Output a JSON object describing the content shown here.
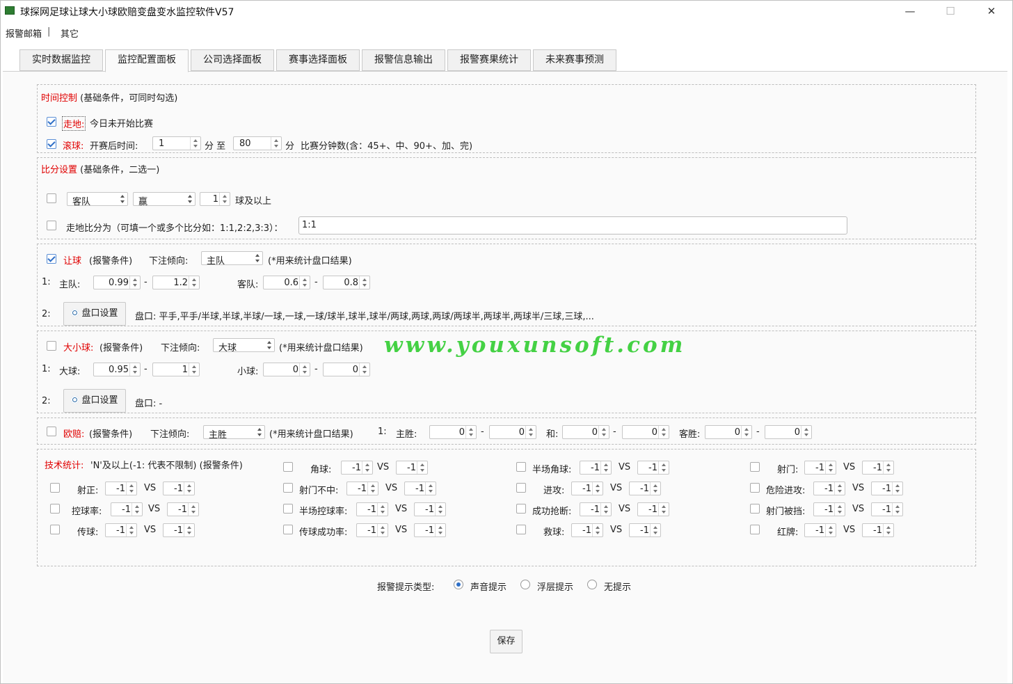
{
  "window": {
    "title": "球探网足球让球大小球欧赔变盘变水监控软件V57",
    "minimize": "—",
    "maximize": "☐",
    "close": "✕",
    "icon_color": "#2e7d32"
  },
  "menu": {
    "item1": "报警邮箱",
    "sep": "|",
    "item2": "其它"
  },
  "tabs": [
    "实时数据监控",
    "监控配置面板",
    "公司选择面板",
    "赛事选择面板",
    "报警信息输出",
    "报警赛果统计",
    "未来赛事预测"
  ],
  "time": {
    "title": "时间控制",
    "subtitle": "(基础条件，可同时勾选)",
    "zoudi_label": "走地:",
    "zoudi_desc": "今日未开始比赛",
    "gunqiu_label": "滚球:",
    "gunqiu_pre": "开赛后时间:",
    "from": "1",
    "fen_zhi": "分 至",
    "to": "80",
    "fen": "分",
    "desc": "比赛分钟数(含：45+、中、90+、加、完)"
  },
  "score": {
    "title": "比分设置",
    "subtitle": "(基础条件，二选一)",
    "team": "客队",
    "result": "赢",
    "goals": "1",
    "goals_suffix": "球及以上",
    "zoudi_label": "走地比分为（可填一个或多个比分如：1:1,2:2,3:3）：",
    "zoudi_value": "1:1"
  },
  "handicap": {
    "title": "让球",
    "cond": "(报警条件)",
    "bias_label": "下注倾向:",
    "bias": "主队",
    "note": "(*用来统计盘口结果)",
    "row1": "1:",
    "home_label": "主队:",
    "home_min": "0.99",
    "home_max": "1.2",
    "away_label": "客队:",
    "away_min": "0.6",
    "away_max": "0.8",
    "dash": "-",
    "row2": "2:",
    "btn": "盘口设置",
    "pankou": "盘口: 平手,平手/半球,半球,半球/一球,一球,一球/球半,球半,球半/两球,两球,两球/两球半,两球半,两球半/三球,三球,..."
  },
  "ou": {
    "title": "大小球:",
    "cond": "(报警条件)",
    "bias_label": "下注倾向:",
    "bias": "大球",
    "note": "(*用来统计盘口结果)",
    "row1": "1:",
    "over_label": "大球:",
    "over_min": "0.95",
    "over_max": "1",
    "under_label": "小球:",
    "under_min": "0",
    "under_max": "0",
    "dash": "-",
    "row2": "2:",
    "btn": "盘口设置",
    "pankou": "盘口: -"
  },
  "euro": {
    "title": "欧赔:",
    "cond": "(报警条件)",
    "bias_label": "下注倾向:",
    "bias": "主胜",
    "note": "(*用来统计盘口结果)",
    "row1": "1:",
    "home_label": "主胜:",
    "home_min": "0",
    "home_max": "0",
    "draw_label": "和:",
    "draw_min": "0",
    "draw_max": "0",
    "away_label": "客胜:",
    "away_min": "0",
    "away_max": "0",
    "dash": "-"
  },
  "tech": {
    "title": "技术统计:",
    "desc": "'N'及以上(-1: 代表不限制) (报警条件)",
    "vs": "VS",
    "items": [
      {
        "label": "角球:",
        "a": "-1",
        "b": "-1"
      },
      {
        "label": "半场角球:",
        "a": "-1",
        "b": "-1"
      },
      {
        "label": "射门:",
        "a": "-1",
        "b": "-1"
      },
      {
        "label": "射正:",
        "a": "-1",
        "b": "-1"
      },
      {
        "label": "射门不中:",
        "a": "-1",
        "b": "-1"
      },
      {
        "label": "进攻:",
        "a": "-1",
        "b": "-1"
      },
      {
        "label": "危险进攻:",
        "a": "-1",
        "b": "-1"
      },
      {
        "label": "控球率:",
        "a": "-1",
        "b": "-1"
      },
      {
        "label": "半场控球率:",
        "a": "-1",
        "b": "-1"
      },
      {
        "label": "成功抢断:",
        "a": "-1",
        "b": "-1"
      },
      {
        "label": "射门被挡:",
        "a": "-1",
        "b": "-1"
      },
      {
        "label": "传球:",
        "a": "-1",
        "b": "-1"
      },
      {
        "label": "传球成功率:",
        "a": "-1",
        "b": "-1"
      },
      {
        "label": "救球:",
        "a": "-1",
        "b": "-1"
      },
      {
        "label": "红牌:",
        "a": "-1",
        "b": "-1"
      }
    ]
  },
  "alert": {
    "label": "报警提示类型:",
    "opt1": "声音提示",
    "opt2": "浮层提示",
    "opt3": "无提示",
    "selected": "声音提示"
  },
  "save": "保存",
  "watermark": "www.youxunsoft.com",
  "colors": {
    "accent_red": "#e00000",
    "check_blue": "#2e6fc7",
    "watermark_green": "#44d144"
  }
}
